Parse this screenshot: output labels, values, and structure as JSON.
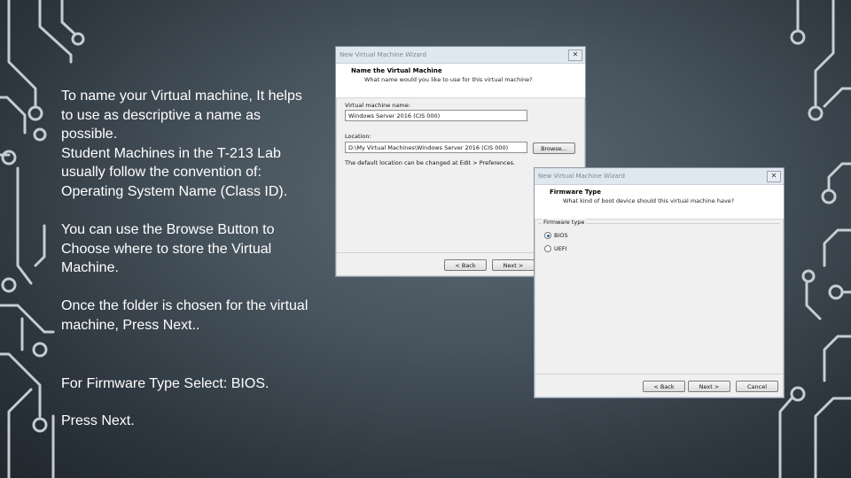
{
  "slide_text": {
    "p1": "To name your Virtual machine, It helps\nto use as descriptive a name as\npossible.\nStudent Machines in the T-213 Lab\nusually follow the convention of:\nOperating System Name (Class ID).",
    "p2": "You can use the Browse Button to\nChoose where to store the Virtual\nMachine.",
    "p3": "Once the folder is chosen for the virtual\nmachine,  Press Next..",
    "p4": "For Firmware Type Select:  BIOS.",
    "p5": "Press Next."
  },
  "dialog1": {
    "window_title": "New Virtual Machine Wizard",
    "close_glyph": "✕",
    "heading": "Name the Virtual Machine",
    "subheading": "What name would you like to use for this virtual machine?",
    "name_label": "Virtual machine name:",
    "name_value": "Windows Server 2016 (CIS 000)",
    "location_label": "Location:",
    "location_value": "D:\\My Virtual Machines\\Windows Server 2016 (CIS 000)",
    "browse_label": "Browse...",
    "hint": "The default location can be changed at Edit > Preferences.",
    "back_label": "< Back",
    "next_label": "Next >"
  },
  "dialog2": {
    "window_title": "New Virtual Machine Wizard",
    "close_glyph": "✕",
    "heading": "Firmware Type",
    "subheading": "What kind of boot device should this virtual machine have?",
    "group_label": "Firmware type",
    "options": [
      "BIOS",
      "UEFI"
    ],
    "selected": "BIOS",
    "back_label": "< Back",
    "next_label": "Next >",
    "cancel_label": "Cancel"
  },
  "colors": {
    "background": "#3a454e",
    "circuit": "#d6dde2",
    "text": "#ffffff"
  }
}
